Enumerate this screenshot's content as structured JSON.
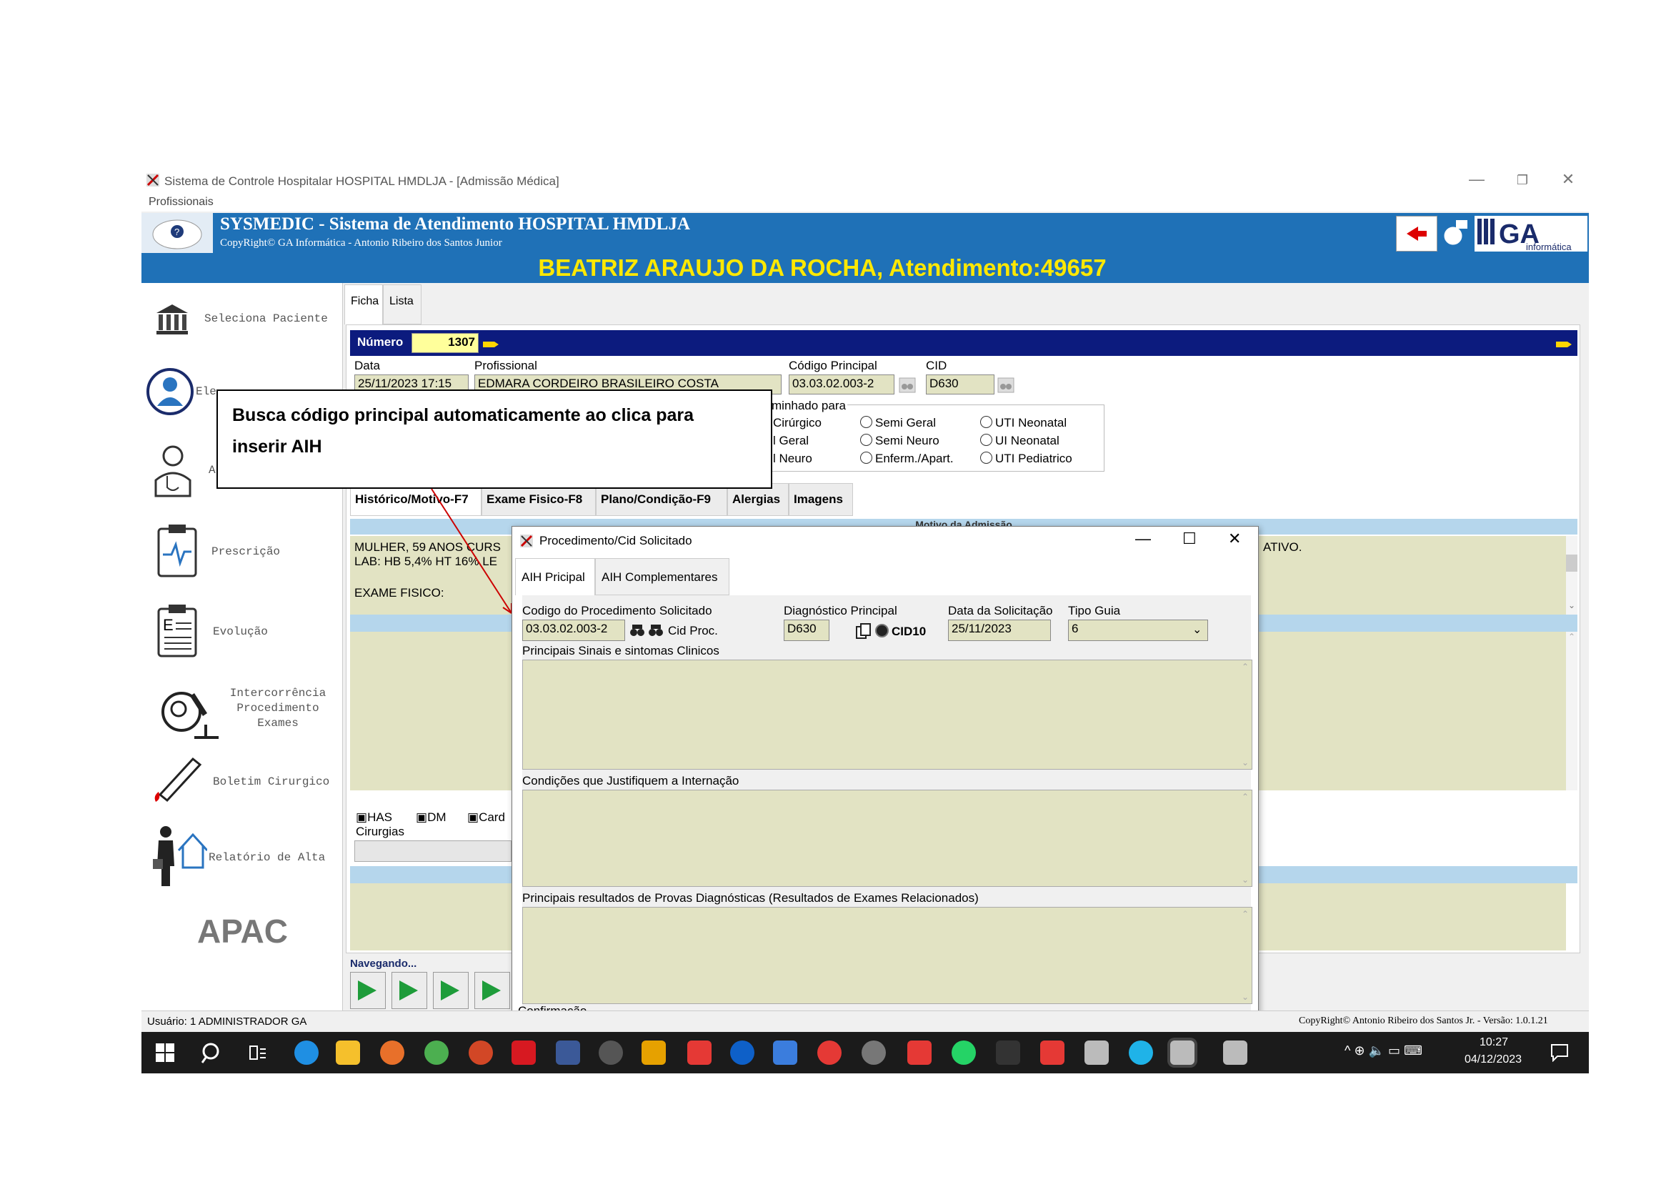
{
  "window": {
    "title": "Sistema de Controle Hospitalar HOSPITAL HMDLJA - [Admissão Médica]",
    "menu": "Profissionais",
    "controls": {
      "minimize": "—",
      "restore": "❐",
      "close": "✕"
    }
  },
  "header": {
    "title": "SYSMEDIC - Sistema de Atendimento HOSPITAL HMDLJA",
    "subtitle": "CopyRight© GA Informática - Antonio Ribeiro dos Santos Junior",
    "help": "?",
    "logo_main": "GA",
    "logo_sub": "informática"
  },
  "patient_bar": "BEATRIZ ARAUJO DA ROCHA, Atendimento:49657",
  "sidebar": {
    "items": [
      {
        "label": "Seleciona Paciente",
        "icon": "building-icon"
      },
      {
        "label": "Ele",
        "icon": "doctor-icon"
      },
      {
        "label": "A",
        "icon": "physician-icon"
      },
      {
        "label": "Prescrição",
        "icon": "clipboard-icon"
      },
      {
        "label": "Evolução",
        "icon": "document-icon"
      },
      {
        "label": "Intercorrência\nProcedimento\nExames",
        "icon": "microscope-icon"
      },
      {
        "label": "Boletim Cirurgico",
        "icon": "scalpel-icon"
      },
      {
        "label": "Relatório de Alta",
        "icon": "discharge-icon"
      }
    ],
    "apac": "APAC"
  },
  "main_tabs": [
    "Ficha",
    "Lista"
  ],
  "ficha": {
    "numero_label": "Número",
    "numero_value": "1307",
    "data_label": "Data",
    "data_value": "25/11/2023 17:15",
    "profissional_label": "Profissional",
    "profissional_value": "EDMARA CORDEIRO BRASILEIRO COSTA",
    "codigo_label": "Código Principal",
    "codigo_value": "03.03.02.003-2",
    "cid_label": "CID",
    "cid_value": "D630",
    "encaminhado_label": "minhado para",
    "radios": [
      "Cirúrgico",
      "Semi Geral",
      "UTI Neonatal",
      "l Geral",
      "Semi Neuro",
      "UI Neonatal",
      "l Neuro",
      "Enferm./Apart.",
      "UTI Pediatrico"
    ]
  },
  "sub_tabs": [
    "Histórico/Motivo-F7",
    "Exame Fisico-F8",
    "Plano/Condição-F9",
    "Alergias",
    "Imagens"
  ],
  "historico": {
    "section_title": "Motivo da Admissão",
    "line1": "MULHER, 59 ANOS CURS",
    "line1_tail": "ATIVO.",
    "line2": "LAB: HB 5,4% HT 16% LE",
    "line3": "EXAME FISICO:"
  },
  "checkboxes": [
    "HAS",
    "DM",
    "Card"
  ],
  "cirurgias_label": "Cirurgias",
  "navegando": "Navegando...",
  "callout": "Busca código principal automaticamente ao clica para inserir AIH",
  "dialog": {
    "title": "Procedimento/Cid Solicitado",
    "tabs": [
      "AIH Pricipal",
      "AIH Complementares"
    ],
    "codigo_label": "Codigo do Procedimento Solicitado",
    "codigo_value": "03.03.02.003-2",
    "cid_proc": "Cid Proc.",
    "diag_label": "Diagnóstico Principal",
    "diag_value": "D630",
    "cid10": "CID10",
    "data_label": "Data da Solicitação",
    "data_value": "25/11/2023",
    "tipo_label": "Tipo Guia",
    "tipo_value": "6",
    "sinais_label": "Principais Sinais e sintomas Clinicos",
    "condicoes_label": "Condições que Justifiquem a Internação",
    "provas_label": "Principais resultados de Provas Diagnósticas (Resultados de Exames Relacionados)",
    "confirmacao": "Confirmação"
  },
  "status": {
    "user": "Usuário: 1  ADMINISTRADOR GA",
    "copyright": "CopyRight© Antonio Ribeiro dos Santos Jr. - Versão: 1.0.1.21"
  },
  "taskbar": {
    "time": "10:27",
    "date": "04/12/2023"
  }
}
